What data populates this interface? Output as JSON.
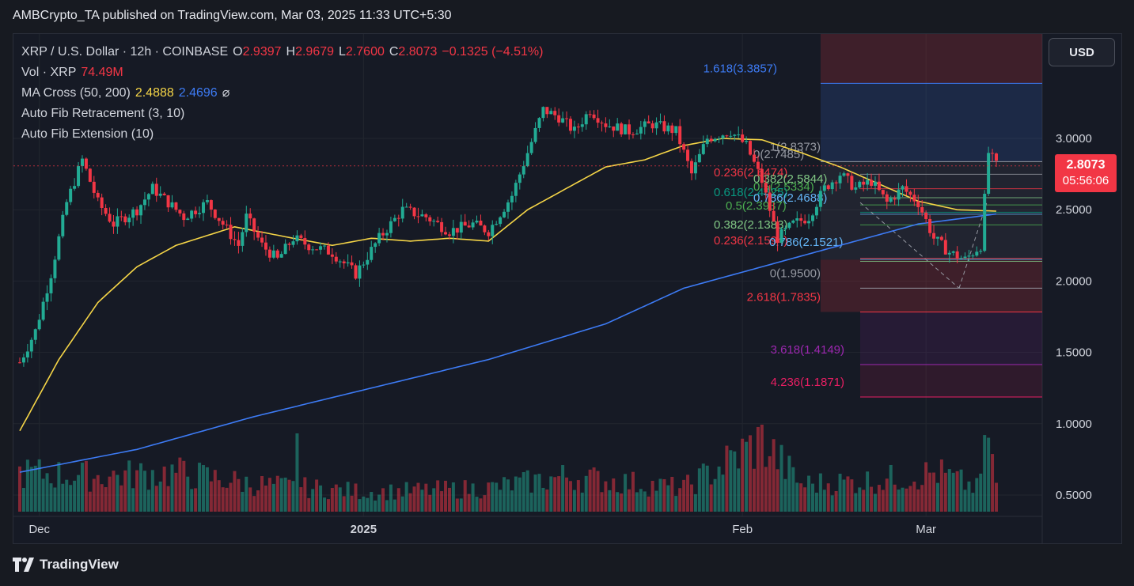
{
  "header": {
    "published": "AMBCrypto_TA published on TradingView.com, Mar 03, 2025 11:33 UTC+5:30"
  },
  "legend": {
    "symbol": "XRP / U.S. Dollar · 12h · COINBASE",
    "ohlc": {
      "o_label": "O",
      "o": "2.9397",
      "h_label": "H",
      "h": "2.9679",
      "l_label": "L",
      "l": "2.7600",
      "c_label": "C",
      "c": "2.8073",
      "change": "−0.1325 (−4.51%)"
    },
    "vol_label": "Vol · XRP",
    "vol_value": "74.49M",
    "ma_label": "MA Cross (50, 200)",
    "ma_50": "2.4888",
    "ma_200": "2.4696",
    "ma_icon": "hidden-icon",
    "fib_retracement": "Auto Fib Retracement (3, 10)",
    "fib_extension": "Auto Fib Extension (10)"
  },
  "currency_button": "USD",
  "price_tag": {
    "price": "2.8073",
    "countdown": "05:56:06"
  },
  "footer": {
    "brand": "TradingView",
    "logo_icon": "tradingview-logo-icon"
  },
  "colors": {
    "up": "#22ab94",
    "down": "#f23645",
    "ma50": "#f5d547",
    "ma200": "#3d7bf5",
    "background": "#161a25"
  },
  "chart_data": {
    "type": "candlestick",
    "timeframe": "12h",
    "y_axis": {
      "ticks": [
        "3.0000",
        "2.5000",
        "2.0000",
        "1.5000",
        "1.0000",
        "0.5000"
      ],
      "scale": "linear"
    },
    "x_axis": {
      "ticks": [
        "Dec",
        "2025",
        "Feb",
        "Mar"
      ]
    },
    "grid": true,
    "price_anchors": [
      [
        0,
        1.43
      ],
      [
        4,
        1.65
      ],
      [
        8,
        2.05
      ],
      [
        12,
        2.55
      ],
      [
        16,
        2.85
      ],
      [
        20,
        2.55
      ],
      [
        24,
        2.4
      ],
      [
        30,
        2.5
      ],
      [
        34,
        2.65
      ],
      [
        38,
        2.55
      ],
      [
        42,
        2.45
      ],
      [
        48,
        2.55
      ],
      [
        52,
        2.4
      ],
      [
        56,
        2.25
      ],
      [
        58,
        2.45
      ],
      [
        62,
        2.25
      ],
      [
        66,
        2.15
      ],
      [
        70,
        2.3
      ],
      [
        74,
        2.25
      ],
      [
        80,
        2.2
      ],
      [
        86,
        2.05
      ],
      [
        92,
        2.3
      ],
      [
        98,
        2.5
      ],
      [
        104,
        2.45
      ],
      [
        110,
        2.35
      ],
      [
        116,
        2.4
      ],
      [
        120,
        2.35
      ],
      [
        126,
        2.6
      ],
      [
        130,
        2.9
      ],
      [
        134,
        3.2
      ],
      [
        138,
        3.15
      ],
      [
        142,
        3.05
      ],
      [
        146,
        3.2
      ],
      [
        150,
        3.1
      ],
      [
        156,
        3.05
      ],
      [
        162,
        3.1
      ],
      [
        168,
        3.05
      ],
      [
        172,
        2.75
      ],
      [
        176,
        3.0
      ],
      [
        182,
        3.05
      ],
      [
        186,
        2.95
      ],
      [
        190,
        2.7
      ],
      [
        194,
        2.3
      ],
      [
        198,
        2.4
      ],
      [
        202,
        2.45
      ],
      [
        206,
        2.65
      ],
      [
        210,
        2.75
      ],
      [
        214,
        2.65
      ],
      [
        218,
        2.7
      ],
      [
        222,
        2.55
      ],
      [
        226,
        2.65
      ],
      [
        230,
        2.55
      ],
      [
        234,
        2.3
      ],
      [
        238,
        2.2
      ],
      [
        242,
        2.15
      ],
      [
        246,
        2.25
      ],
      [
        248,
        2.9
      ],
      [
        250,
        2.81
      ]
    ],
    "volume_anchors": [
      [
        0,
        0.5
      ],
      [
        20,
        0.45
      ],
      [
        40,
        0.5
      ],
      [
        60,
        0.35
      ],
      [
        90,
        0.25
      ],
      [
        120,
        0.3
      ],
      [
        140,
        0.45
      ],
      [
        170,
        0.3
      ],
      [
        190,
        0.9
      ],
      [
        200,
        0.35
      ],
      [
        220,
        0.4
      ],
      [
        235,
        0.5
      ],
      [
        245,
        0.3
      ],
      [
        248,
        0.9
      ],
      [
        250,
        0.35
      ]
    ],
    "spikes": [
      [
        71,
        0.9
      ],
      [
        190,
        1.0
      ],
      [
        248,
        0.85
      ]
    ],
    "ma50_anchors": [
      [
        0,
        0.95
      ],
      [
        10,
        1.45
      ],
      [
        20,
        1.85
      ],
      [
        30,
        2.1
      ],
      [
        40,
        2.25
      ],
      [
        55,
        2.38
      ],
      [
        70,
        2.3
      ],
      [
        80,
        2.25
      ],
      [
        90,
        2.3
      ],
      [
        100,
        2.28
      ],
      [
        110,
        2.3
      ],
      [
        120,
        2.28
      ],
      [
        130,
        2.5
      ],
      [
        140,
        2.65
      ],
      [
        150,
        2.8
      ],
      [
        160,
        2.85
      ],
      [
        170,
        2.95
      ],
      [
        180,
        3.0
      ],
      [
        190,
        2.99
      ],
      [
        200,
        2.9
      ],
      [
        210,
        2.8
      ],
      [
        220,
        2.68
      ],
      [
        230,
        2.56
      ],
      [
        240,
        2.5
      ],
      [
        250,
        2.49
      ]
    ],
    "ma200_anchors": [
      [
        0,
        0.66
      ],
      [
        30,
        0.82
      ],
      [
        60,
        1.05
      ],
      [
        90,
        1.25
      ],
      [
        120,
        1.45
      ],
      [
        150,
        1.7
      ],
      [
        170,
        1.95
      ],
      [
        190,
        2.1
      ],
      [
        210,
        2.25
      ],
      [
        230,
        2.4
      ],
      [
        250,
        2.47
      ]
    ],
    "fib_extension_levels": [
      {
        "label": "1.618(3.3857)",
        "value": 3.3857,
        "color": "#3d7bf5"
      },
      {
        "label": "1(2.8373)",
        "value": 2.8373,
        "color": "#9598a1"
      },
      {
        "label": "0(1.9500)",
        "value": 1.95,
        "color": "#9598a1"
      },
      {
        "label": "2.618(1.7835)",
        "value": 1.7835,
        "color": "#f23645"
      },
      {
        "label": "3.618(1.4149)",
        "value": 1.4149,
        "color": "#9c27b0"
      },
      {
        "label": "4.236(1.1871)",
        "value": 1.1871,
        "color": "#e91e63"
      }
    ],
    "fib_retracement_levels": [
      {
        "label": "0(2.7485)",
        "value": 2.7485,
        "color": "#9598a1"
      },
      {
        "label": "0.236(2.6474)",
        "value": 2.6474,
        "color": "#f23645"
      },
      {
        "label": "0.382(2.5844)",
        "value": 2.5844,
        "color": "#81c784"
      },
      {
        "label": "0.5(2.5334)",
        "value": 2.5334,
        "color": "#4caf50"
      },
      {
        "label": "0.618(2.4825)",
        "value": 2.4825,
        "color": "#089981"
      },
      {
        "label": "0.786(2.4688)",
        "value": 2.4688,
        "color": "#64b5f6"
      },
      {
        "label": "0.5(2.3937)",
        "value": 2.3937,
        "color": "#4caf50"
      },
      {
        "label": "0.382(2.1383)",
        "value": 2.1383,
        "color": "#81c784"
      },
      {
        "label": "0.236(2.1594)",
        "value": 2.1594,
        "color": "#f23645"
      },
      {
        "label": "0.786(2.1521)",
        "value": 2.1521,
        "color": "#64b5f6"
      }
    ]
  }
}
